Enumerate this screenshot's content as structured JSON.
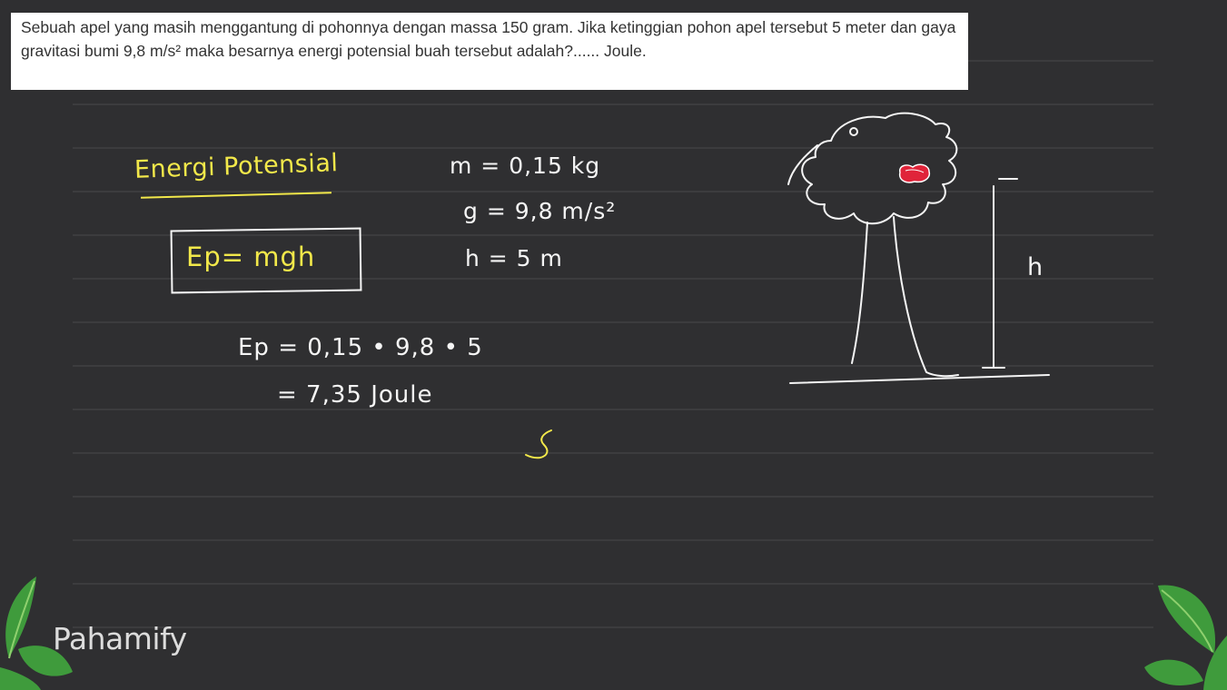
{
  "question": {
    "text": "Sebuah apel yang masih menggantung di pohonnya dengan massa 150 gram. Jika ketinggian pohon apel tersebut 5 meter dan gaya gravitasi bumi 9,8 m/s² maka besarnya energi potensial buah tersebut adalah?...... Joule."
  },
  "notes": {
    "title": "Energi Potensial",
    "formula": "Ep= mgh",
    "mass": "m = 0,15 kg",
    "gravity": "g = 9,8 m/s²",
    "height": "h =    5 m",
    "calc_line1": "Ep = 0,15 • 9,8 • 5",
    "calc_line2": "= 7,35 Joule",
    "tree_height_label": "h"
  },
  "brand": {
    "name": "Pahamify"
  },
  "colors": {
    "background": "#2f2f31",
    "ink_yellow": "#f2e84a",
    "ink_white": "#f5f5f5",
    "apple_red": "#e0243a",
    "leaf_green": "#3f9b3c"
  },
  "icons": [
    "apple-icon",
    "leaf-icon",
    "tree-drawing"
  ]
}
